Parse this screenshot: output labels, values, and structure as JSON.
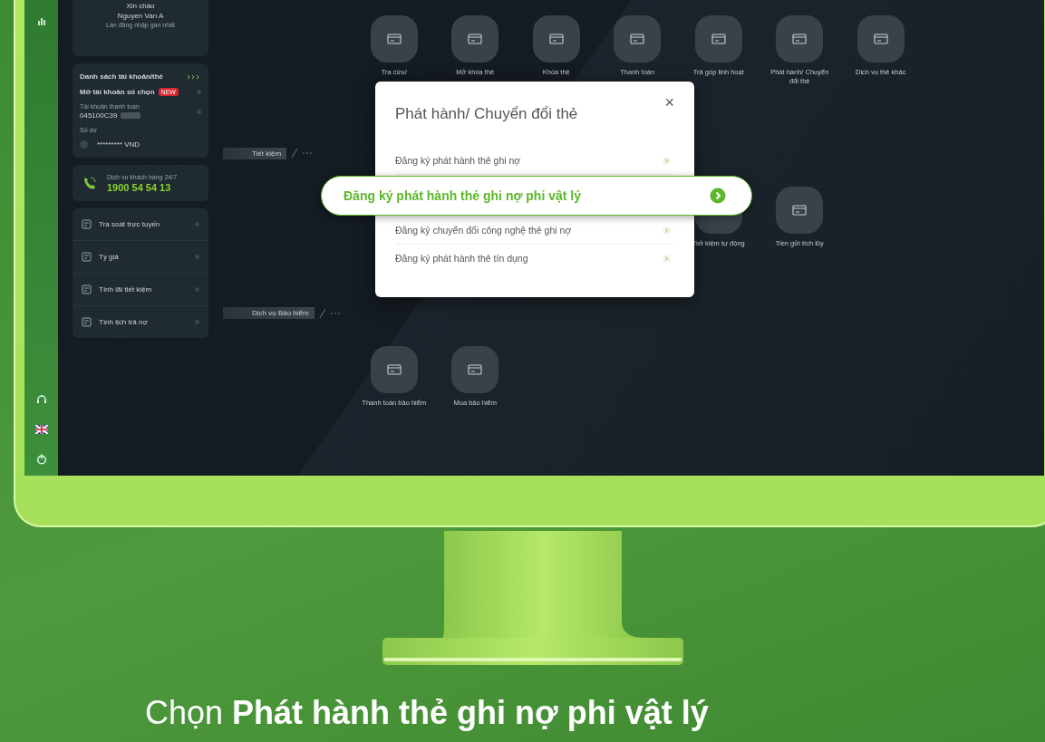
{
  "sidebar": {
    "greeting": "Xin chào",
    "user_name": "Nguyen Van A",
    "last_login_label": "Lần đăng nhập gần nhất",
    "accounts": {
      "title": "Danh sách tài khoản/thẻ",
      "open_account": "Mở tài khoản số chọn",
      "badge": "NEW",
      "account_type": "Tài khoản thanh toán",
      "account_number": "045100C39",
      "balance_label": "Số dư",
      "balance": "********* VND"
    },
    "hotline": {
      "label": "Dịch vụ khách hàng 24/7",
      "number": "1900 54 54 13"
    },
    "tools": [
      {
        "label": "Tra soát trực tuyến"
      },
      {
        "label": "Tỷ giá"
      },
      {
        "label": "Tính lãi tiết kiệm"
      },
      {
        "label": "Tính lịch trả nợ"
      }
    ]
  },
  "card_services": {
    "items": [
      {
        "label": "Tra cứu/"
      },
      {
        "label": "Mở khóa thẻ"
      },
      {
        "label": "Khóa thẻ"
      },
      {
        "label": "Thanh toán"
      },
      {
        "label": "Trả góp linh hoạt"
      },
      {
        "label": "Phát hành/ Chuyển đổi thẻ"
      },
      {
        "label": "Dịch vụ thẻ khác"
      }
    ]
  },
  "savings": {
    "title": "Tiết kiệm",
    "items": [
      {
        "label": "Tiết kiệm tự động"
      },
      {
        "label": "Tiền gửi tích lũy"
      }
    ]
  },
  "insurance": {
    "title": "Dịch vụ Bảo hiểm",
    "items": [
      {
        "label": "Thanh toán bảo hiểm"
      },
      {
        "label": "Mua bảo hiểm"
      }
    ]
  },
  "modal": {
    "title": "Phát hành/ Chuyển đổi thẻ",
    "close": "×",
    "items": [
      {
        "label": "Đăng ký phát hành thẻ ghi nợ",
        "selected": false
      },
      {
        "label": "Đăng ký phát hành thẻ ghi nợ phi vật lý",
        "selected": true
      },
      {
        "label": "Đăng ký chuyển đổi công nghệ thẻ ghi nợ",
        "selected": false
      },
      {
        "label": "Đăng ký phát hành thẻ tín dụng",
        "selected": false
      }
    ]
  },
  "caption": "Chọn **Phát hành thẻ ghi nợ phi vật lý**"
}
